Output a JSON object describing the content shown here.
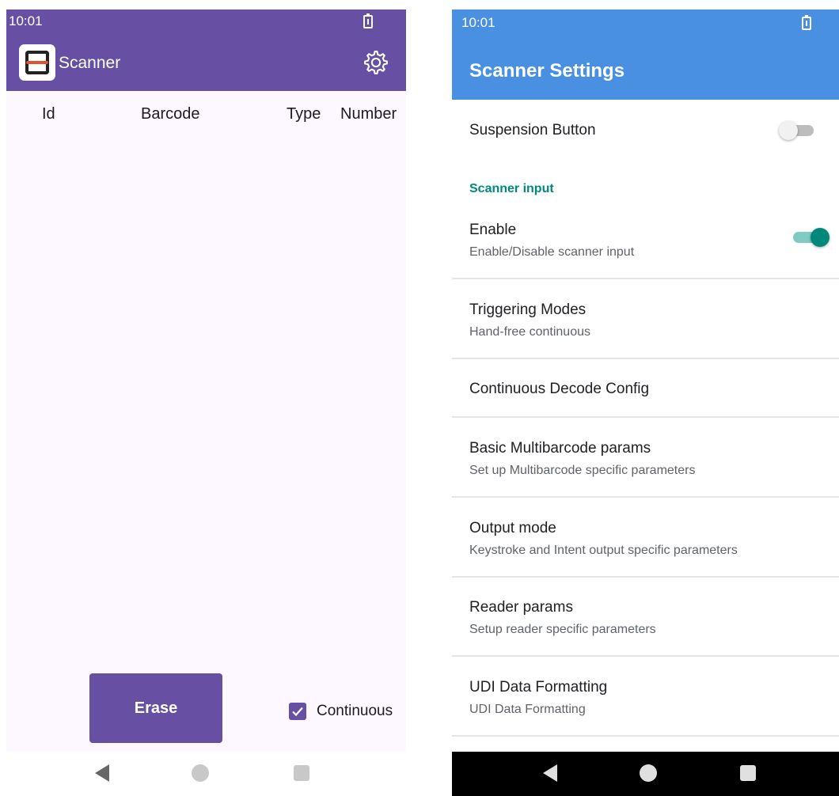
{
  "scanner_app": {
    "status_time": "10:01",
    "battery_icon": "battery-charging-icon",
    "title": "Scanner",
    "settings_icon": "gear-icon",
    "columns": [
      "Id",
      "Barcode",
      "Type",
      "Number"
    ],
    "erase_label": "Erase",
    "continuous_label": "Continuous",
    "continuous_checked": true,
    "theme_color": "#6750a4",
    "background_color": "#fdf7ff"
  },
  "settings_app": {
    "status_time": "10:01",
    "title": "Scanner Settings",
    "header_color": "#4a90e2",
    "accent_color": "#00897b",
    "suspension": {
      "title": "Suspension Button",
      "enabled": false
    },
    "section_scanner_input": "Scanner input",
    "enable": {
      "title": "Enable",
      "subtitle": "Enable/Disable scanner input",
      "enabled": true
    },
    "items": [
      {
        "title": "Triggering Modes",
        "subtitle": "Hand-free continuous"
      },
      {
        "title": "Continuous Decode Config",
        "subtitle": ""
      },
      {
        "title": "Basic Multibarcode params",
        "subtitle": "Set up Multibarcode specific parameters"
      },
      {
        "title": "Output mode",
        "subtitle": "Keystroke and Intent output specific parameters"
      },
      {
        "title": "Reader params",
        "subtitle": "Setup reader specific parameters"
      },
      {
        "title": "UDI Data Formatting",
        "subtitle": "UDI Data Formatting"
      }
    ]
  },
  "navbar": {
    "back_icon": "back-triangle-icon",
    "home_icon": "home-circle-icon",
    "recents_icon": "recents-square-icon"
  }
}
